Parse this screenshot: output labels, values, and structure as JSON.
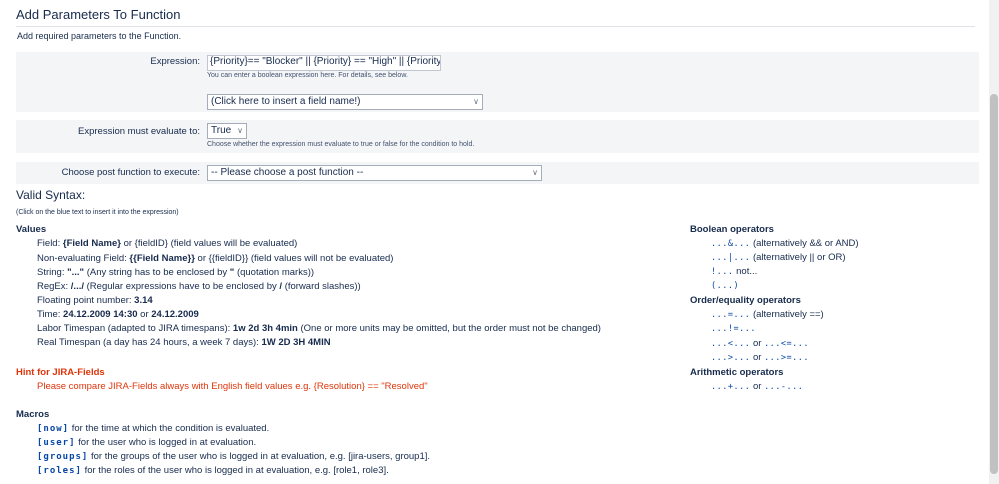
{
  "header": {
    "title": "Add Parameters To Function",
    "description": "Add required parameters to the Function."
  },
  "expression": {
    "label": "Expression:",
    "value": "{Priority}== \"Blocker\" || {Priority} == \"High\" || {Priority}",
    "hint": "You can enter a boolean expression here. For details, see below.",
    "field_select": "(Click here to insert a field name!)"
  },
  "evaluate": {
    "label": "Expression must evaluate to:",
    "value": "True",
    "hint": "Choose whether the expression must evaluate to true or false for the condition to hold."
  },
  "post_function": {
    "label": "Choose post function to execute:",
    "value": "-- Please choose a post function --"
  },
  "syntax": {
    "title": "Valid Syntax:",
    "hint": "(Click on the blue text to insert it into the expression)"
  },
  "values": {
    "heading": "Values",
    "field": {
      "a": "Field:",
      "b": "{Field Name}",
      "c": "or {fieldID} (field values will be evaluated)"
    },
    "nonfield": {
      "a": "Non-evaluating Field:",
      "b": "{{Field Name}}",
      "c": "or {{fieldID}} (field values will not be evaluated)"
    },
    "string": {
      "a": "String:",
      "b": "\"...\"",
      "c": "(Any string has to be enclosed by",
      "d": "\"",
      "e": "(quotation marks))"
    },
    "regex": {
      "a": "RegEx:",
      "b": "/.../",
      "c": "(Regular expressions have to be enclosed by",
      "d": "/",
      "e": "(forward slashes))"
    },
    "float": {
      "a": "Floating point number:",
      "b": "3.14"
    },
    "time": {
      "a": "Time:",
      "b": "24.12.2009 14:30",
      "c": "or",
      "d": "24.12.2009"
    },
    "labor": {
      "a": "Labor Timespan (adapted to JIRA timespans):",
      "b": "1w 2d 3h 4min",
      "c": "(One or more units may be omitted, but the order must not be changed)"
    },
    "real": {
      "a": "Real Timespan (a day has 24 hours, a week 7 days):",
      "b": "1W 2D 3H 4MIN"
    }
  },
  "hint_jira": {
    "heading": "Hint for JIRA-Fields",
    "text": "Please compare JIRA-Fields always with English field values e.g. {Resolution} == \"Resolved\""
  },
  "macros": {
    "heading": "Macros",
    "items": [
      {
        "name": "[now]",
        "desc": "for the time at which the condition is evaluated."
      },
      {
        "name": "[user]",
        "desc": "for the user who is logged in at evaluation."
      },
      {
        "name": "[groups]",
        "desc": "for the groups of the user who is logged in at evaluation, e.g. [jira-users, group1]."
      },
      {
        "name": "[roles]",
        "desc": "for the roles of the user who is logged in at evaluation, e.g. [role1, role3]."
      }
    ]
  },
  "operators": {
    "boolean_heading": "Boolean operators",
    "and": {
      "op": "...&...",
      "note": "(alternatively && or AND)"
    },
    "or": {
      "op": "...|...",
      "note": "(alternatively || or OR)"
    },
    "not": {
      "op": "!...",
      "note": "not..."
    },
    "paren": {
      "op": "(...)"
    },
    "order_heading": "Order/equality operators",
    "eq": {
      "op": "...=...",
      "note": "(alternatively ==)"
    },
    "neq": {
      "op": "...!=..."
    },
    "lt": {
      "op1": "...<...",
      "or": "or",
      "op2": "...<=..."
    },
    "gt": {
      "op1": "...>...",
      "or": "or",
      "op2": "...>=..."
    },
    "arith_heading": "Arithmetic operators",
    "arith": {
      "op1": "...+...",
      "or": "or",
      "op2": "...-..."
    }
  },
  "colors": {
    "link": "#0747a6",
    "hint_red": "#de350b",
    "row_bg": "#f4f5f7"
  }
}
